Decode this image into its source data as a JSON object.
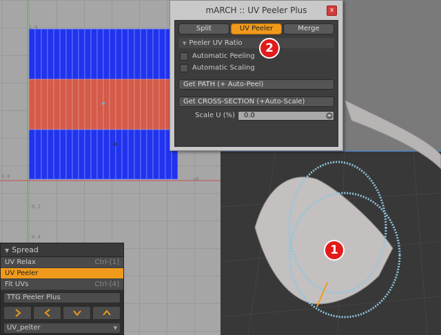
{
  "window": {
    "title": "mARCH :: UV Peeler Plus",
    "close_label": "x",
    "tabs": [
      {
        "label": "Split",
        "active": false
      },
      {
        "label": "UV Peeler",
        "active": true
      },
      {
        "label": "Merge",
        "active": false
      }
    ],
    "section_title": "Peeler UV Ratio",
    "checkboxes": [
      {
        "label": "Automatic Peeling",
        "checked": false
      },
      {
        "label": "Automatic Scaling",
        "checked": false
      }
    ],
    "buttons": [
      {
        "label": "Get PATH (+ Auto-Peel)"
      },
      {
        "label": "Get CROSS-SECTION (+Auto-Scale)"
      }
    ],
    "scale_label": "Scale U (%)",
    "scale_value": "0.0"
  },
  "spread": {
    "title": "Spread",
    "items": [
      {
        "label": "UV Relax",
        "shortcut": "Ctrl-[1]",
        "active": false
      },
      {
        "label": "UV Peeler",
        "shortcut": "",
        "active": true
      },
      {
        "label": "Fit UVs",
        "shortcut": "Ctrl-[4]",
        "active": false
      }
    ],
    "peeler_button": "TTG Peeler Plus",
    "arrows": [
      "right-arrow-icon",
      "left-arrow-icon",
      "down-arrow-icon",
      "up-arrow-icon"
    ],
    "select_value": "UV_pelter"
  },
  "rulers": {
    "top_left": "1.0",
    "left_mid": "0.2",
    "left_low": "0.4",
    "origin": "0.0",
    "bottom": "-0.2",
    "bottom2": "-0.4",
    "right": "+0"
  },
  "badges": {
    "one": "1",
    "two": "2"
  },
  "colors": {
    "accent": "#f09a1c",
    "uv_blue": "#2233ee",
    "uv_red": "#d45a4a",
    "badge": "#e21b1b"
  }
}
